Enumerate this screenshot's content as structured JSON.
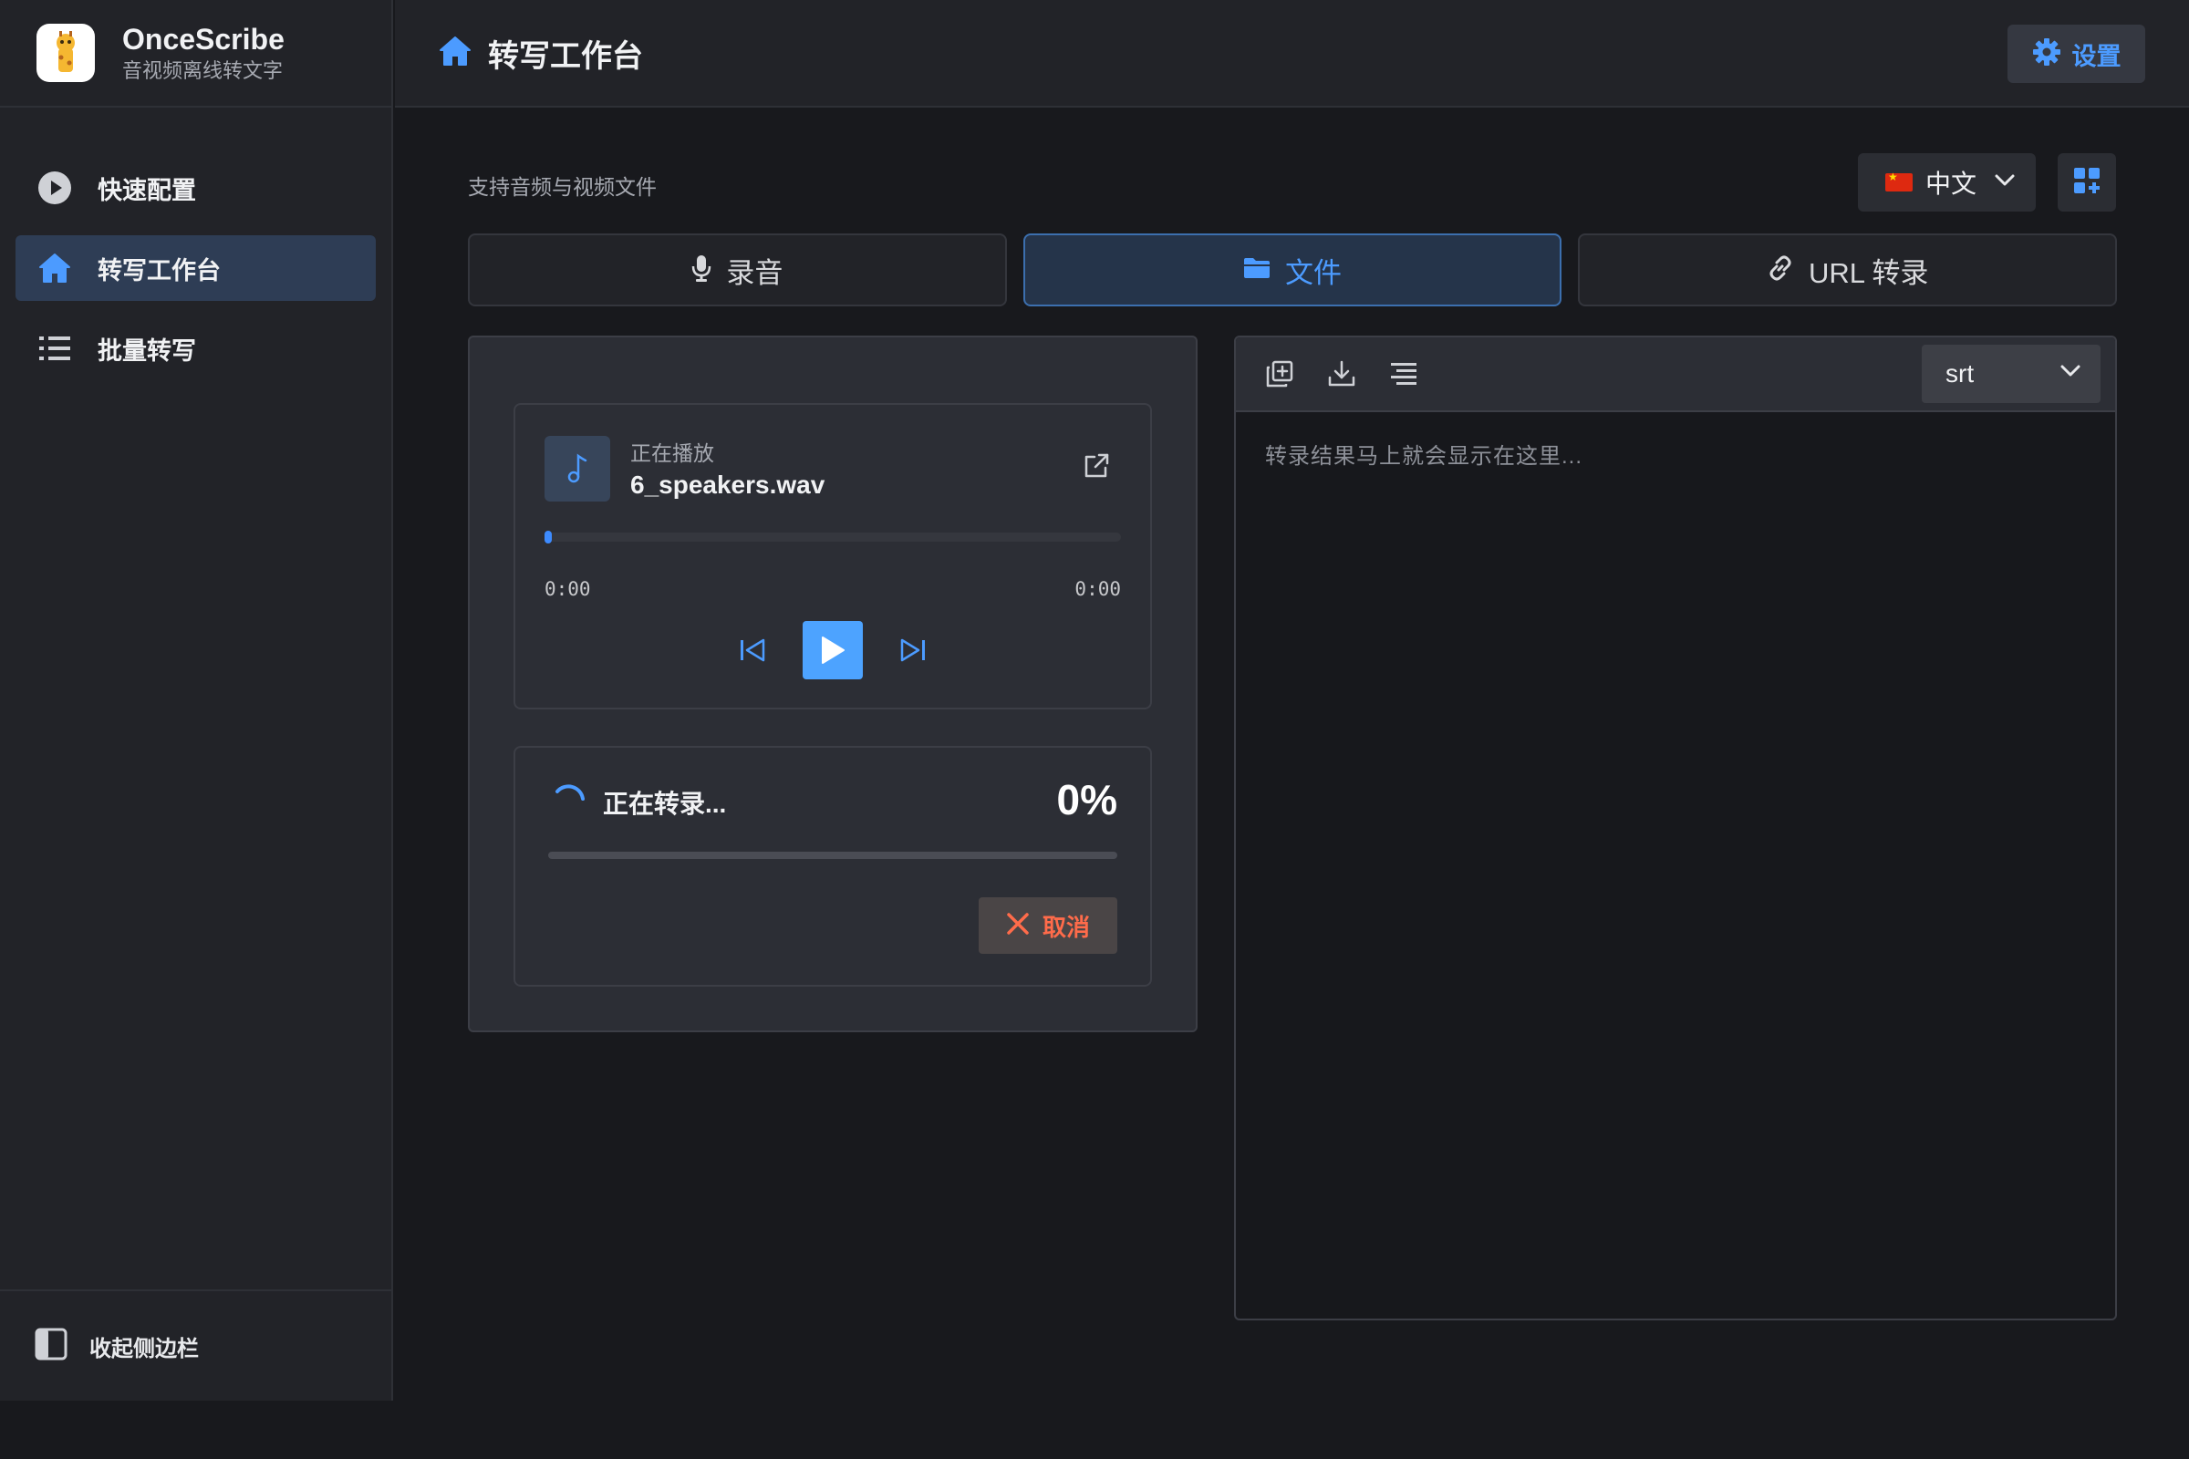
{
  "app": {
    "name": "OnceScribe",
    "subtitle": "音视频离线转文字"
  },
  "sidebar": {
    "items": [
      {
        "label": "快速配置",
        "icon": "play-circle-icon",
        "active": false
      },
      {
        "label": "转写工作台",
        "icon": "home-icon",
        "active": true
      },
      {
        "label": "批量转写",
        "icon": "list-icon",
        "active": false
      }
    ],
    "footer_label": "收起侧边栏"
  },
  "header": {
    "title": "转写工作台",
    "settings_label": "设置"
  },
  "main": {
    "support_text": "支持音频与视频文件",
    "language": "中文",
    "tabs": [
      {
        "label": "录音",
        "icon": "microphone-icon",
        "active": false
      },
      {
        "label": "文件",
        "icon": "folder-icon",
        "active": true
      },
      {
        "label": "URL 转录",
        "icon": "link-icon",
        "active": false
      }
    ]
  },
  "player": {
    "status": "正在播放",
    "file_name": "6_speakers.wav",
    "current_time": "0:00",
    "duration": "0:00",
    "position_fraction": 0
  },
  "transcription": {
    "status": "正在转录...",
    "percent_label": "0%",
    "percent": 0,
    "cancel_label": "取消"
  },
  "result": {
    "format": "srt",
    "placeholder": "转录结果马上就会显示在这里..."
  },
  "colors": {
    "accent": "#4da3ff",
    "cancel": "#ff6b4a",
    "background": "#18191d",
    "panel": "#2c2e35"
  }
}
